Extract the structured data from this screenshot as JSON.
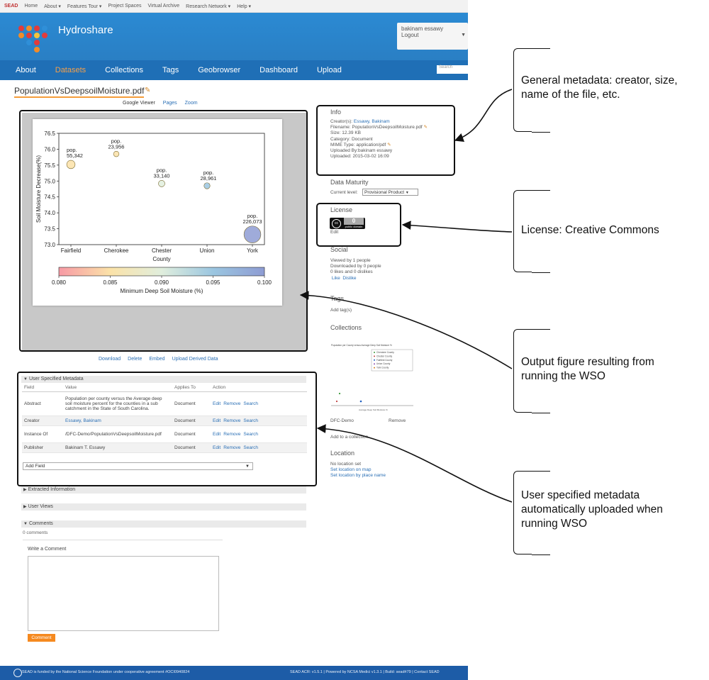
{
  "topbar": {
    "brand": "SEAD",
    "items": [
      "Home",
      "About ▾",
      "Features Tour ▾",
      "Project Spaces",
      "Virtual Archive",
      "Research Network ▾",
      "Help ▾"
    ]
  },
  "header": {
    "app_title": "Hydroshare",
    "user_name": "bakinam essawy",
    "logout": "Logout"
  },
  "nav": {
    "items": [
      "About",
      "Datasets",
      "Collections",
      "Tags",
      "Geobrowser",
      "Dashboard",
      "Upload"
    ],
    "active": "Datasets",
    "search_placeholder": "Search"
  },
  "file": {
    "name": "PopulationVsDeepsoilMoisture.pdf",
    "viewer_tabs": [
      "Google Viewer",
      "Pages",
      "Zoom"
    ],
    "actions": [
      "Download",
      "Delete",
      "Embed",
      "Upload Derived Data"
    ]
  },
  "chart_data": {
    "type": "scatter",
    "xlabel": "County",
    "ylabel": "Soil Moisture Decrease(%)",
    "categories": [
      "Fairfield",
      "Cherokee",
      "Chester",
      "Union",
      "York"
    ],
    "ylim": [
      73.0,
      76.5
    ],
    "yticks": [
      "73.0",
      "73.5",
      "74.0",
      "74.5",
      "75.0",
      "75.5",
      "76.0",
      "76.5"
    ],
    "points": [
      {
        "x": "Fairfield",
        "y": 75.52,
        "population": 55342,
        "label_top": "pop.",
        "label_bottom": "55,342",
        "min_deep_moisture": 0.086
      },
      {
        "x": "Cherokee",
        "y": 75.85,
        "population": 23956,
        "label_top": "pop.",
        "label_bottom": "23,956",
        "min_deep_moisture": 0.087
      },
      {
        "x": "Chester",
        "y": 74.92,
        "population": 33140,
        "label_top": "pop.",
        "label_bottom": "33,140",
        "min_deep_moisture": 0.092
      },
      {
        "x": "Union",
        "y": 74.85,
        "population": 28961,
        "label_top": "pop.",
        "label_bottom": "28,961",
        "min_deep_moisture": 0.093
      },
      {
        "x": "York",
        "y": 73.32,
        "population": 226073,
        "label_top": "pop.",
        "label_bottom": "226,073",
        "min_deep_moisture": 0.1
      }
    ],
    "colorbar": {
      "label": "Minimum Deep Soil Moisture (%)",
      "range": [
        0.08,
        0.1
      ],
      "ticks": [
        "0.080",
        "0.085",
        "0.090",
        "0.095",
        "0.100"
      ],
      "colors": [
        "#f79aa5",
        "#fbe2a8",
        "#e0eedd",
        "#9bc6e0",
        "#8e9cd3"
      ]
    }
  },
  "metadata": {
    "header": "User Specified Metadata",
    "columns": [
      "Field",
      "Value",
      "Applies To",
      "Action"
    ],
    "rows": [
      {
        "field": "Abstract",
        "value": "Population per county versus the Average deep soil moisture percent for the counties in a sub catchment in the State of South Carolina.",
        "applies": "Document",
        "edit": "Edit",
        "remove": "Remove",
        "search": "Search"
      },
      {
        "field": "Creator",
        "value": "Essawy, Bakinam",
        "applies": "Document",
        "edit": "Edit",
        "remove": "Remove",
        "search": "Search"
      },
      {
        "field": "Instance Of",
        "value": "/DFC-Demo/PopulationVsDeepsoilMoisture.pdf",
        "applies": "Document",
        "edit": "Edit",
        "remove": "Remove",
        "search": "Search"
      },
      {
        "field": "Publisher",
        "value": "Bakinam T. Essawy",
        "applies": "Document",
        "edit": "Edit",
        "remove": "Remove",
        "search": "Search"
      }
    ],
    "add_field": "Add Field"
  },
  "sections": {
    "extracted": "Extracted Information",
    "user_views": "User Views",
    "comments": "Comments",
    "comments_count": "0 comments",
    "write_comment": "Write a Comment",
    "comment_button": "Comment"
  },
  "info": {
    "title": "Info",
    "creator_label": "Creator(s):",
    "creator_value": "Essawy, Bakinam",
    "filename": "Filename: PopulationVsDeepsoilMoisture.pdf",
    "size": "Size: 12.39 KB",
    "category": "Category: Document",
    "mime": "MIME Type: application/pdf",
    "uploaded_by": "Uploaded By:bakinam essawy",
    "uploaded": "Uploaded: 2015-03-02 16:09"
  },
  "maturity": {
    "title": "Data Maturity",
    "label": "Current level:",
    "value": "Provisional Product"
  },
  "license": {
    "title": "License",
    "edit": "Edit",
    "badge_main": "0",
    "badge_sub": "public domain"
  },
  "social": {
    "title": "Social",
    "viewed": "Viewed by 1 people",
    "downloaded": "Downloaded by 0 people",
    "likes": "0 likes and 0 dislikes",
    "like": "Like",
    "dislike": "Dislike"
  },
  "tags": {
    "title": "Tags",
    "add": "Add tag(s)"
  },
  "collections": {
    "title": "Collections",
    "thumb_title": "Population per County versus Average Deep Soil Moisture %",
    "thumb_legend": [
      "Cherokee County",
      "Chester County",
      "Fairfield County",
      "Union County",
      "York County"
    ],
    "thumb_xlabel": "Average Deep Soil Moisture %",
    "name": "DFC-Demo",
    "remove": "Remove",
    "add": "Add to a collection"
  },
  "location": {
    "title": "Location",
    "none": "No location set",
    "set_map": "Set location on map",
    "set_name": "Set location by place name"
  },
  "footer": {
    "left": "SEAD is funded by the National Science Foundation under cooperative agreement #OCI0940824",
    "right": "SEAD ACR: v1.5.1 | Powered by NCSA Medici v1.3.1 | Build: sead#79 | Contact SEAD"
  },
  "annotations": [
    "General metadata: creator, size, name of the file, etc.",
    "License: Creative Commons",
    "Output figure resulting from running the WSO",
    "User specified metadata automatically uploaded when running WSO"
  ]
}
